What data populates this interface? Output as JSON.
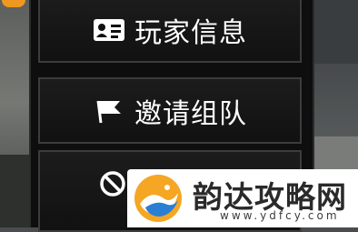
{
  "menu": {
    "items": [
      {
        "label": "玩家信息",
        "icon": "id-card-icon"
      },
      {
        "label": "邀请组队",
        "icon": "flag-icon"
      },
      {
        "label": "",
        "icon": "block-icon"
      }
    ]
  },
  "watermark": {
    "brand_text": "韵达攻略网",
    "url": "www.ydfcy.com",
    "logo": "bird-logo-icon",
    "colors": {
      "orange": "#f5a623",
      "blue": "#2a7fd4"
    }
  }
}
